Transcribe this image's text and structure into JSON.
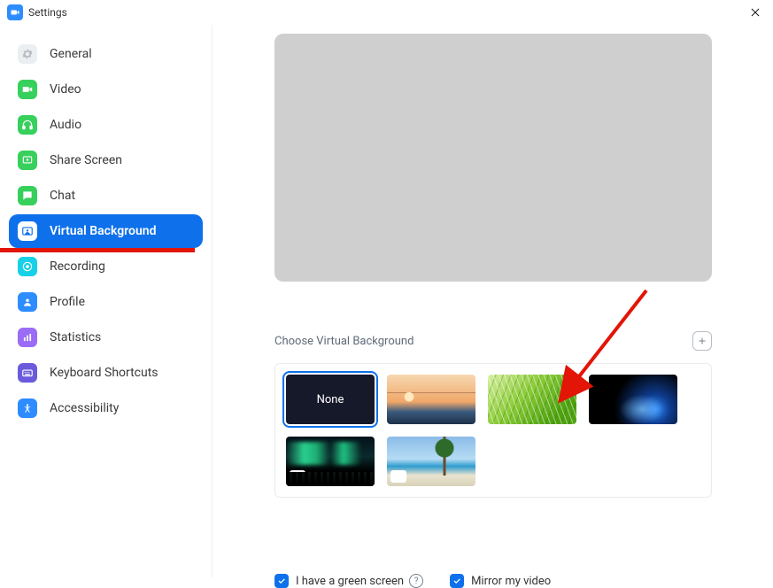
{
  "titlebar": {
    "title": "Settings"
  },
  "sidebar": {
    "items": [
      {
        "id": "general",
        "label": "General"
      },
      {
        "id": "video",
        "label": "Video"
      },
      {
        "id": "audio",
        "label": "Audio"
      },
      {
        "id": "share",
        "label": "Share Screen"
      },
      {
        "id": "chat",
        "label": "Chat"
      },
      {
        "id": "vb",
        "label": "Virtual Background",
        "active": true
      },
      {
        "id": "recording",
        "label": "Recording"
      },
      {
        "id": "profile",
        "label": "Profile"
      },
      {
        "id": "stats",
        "label": "Statistics"
      },
      {
        "id": "keyboard",
        "label": "Keyboard Shortcuts"
      },
      {
        "id": "access",
        "label": "Accessibility"
      }
    ]
  },
  "main": {
    "section_label": "Choose Virtual Background",
    "backgrounds": [
      {
        "id": "none",
        "kind": "none",
        "label": "None",
        "selected": true
      },
      {
        "id": "bridge",
        "kind": "image",
        "desc": "golden-gate-bridge"
      },
      {
        "id": "grass",
        "kind": "image",
        "desc": "grass"
      },
      {
        "id": "earth",
        "kind": "image",
        "desc": "earth-from-space"
      },
      {
        "id": "aurora",
        "kind": "video",
        "desc": "aurora"
      },
      {
        "id": "beach",
        "kind": "video",
        "desc": "beach"
      }
    ],
    "options": {
      "green_screen": {
        "label": "I have a green screen",
        "checked": true
      },
      "mirror": {
        "label": "Mirror my video",
        "checked": true
      }
    }
  }
}
